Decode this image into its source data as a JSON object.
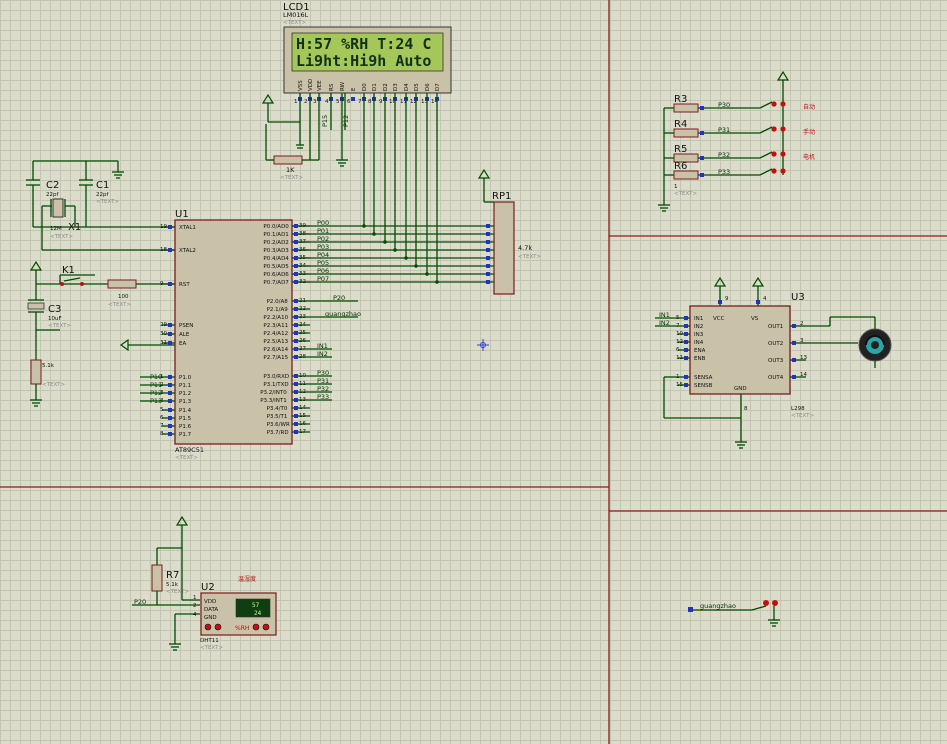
{
  "lcd": {
    "ref": "LCD1",
    "part": "LM016L",
    "text": "<TEXT>",
    "line1": "H:57 %RH T:24 C",
    "line2": "Li9ht:Hi9h  Auto",
    "pins": [
      "VSS",
      "VDD",
      "VEE",
      "RS",
      "RW",
      "E",
      "D0",
      "D1",
      "D2",
      "D3",
      "D4",
      "D5",
      "D6",
      "D7"
    ],
    "pin_nums": [
      "1",
      "2",
      "3",
      "4",
      "5",
      "6",
      "7",
      "8",
      "9",
      "10",
      "11",
      "12",
      "13",
      "14"
    ],
    "net_p15": "P15",
    "net_p12": "P12"
  },
  "mcu": {
    "ref": "U1",
    "part": "AT89C51",
    "text": "<TEXT>",
    "left_pins": [
      "XTAL1",
      "XTAL2",
      "RST",
      "PSEN",
      "ALE",
      "EA",
      "P1.0",
      "P1.1",
      "P1.2",
      "P1.3",
      "P1.4",
      "P1.5",
      "P1.6",
      "P1.7"
    ],
    "left_nums": [
      "19",
      "18",
      "9",
      "29",
      "30",
      "31",
      "1",
      "2",
      "3",
      "4",
      "5",
      "6",
      "7",
      "8"
    ],
    "right_pins": [
      "P0.0/AD0",
      "P0.1/AD1",
      "P0.2/AD2",
      "P0.3/AD3",
      "P0.4/AD4",
      "P0.5/AD5",
      "P0.6/AD6",
      "P0.7/AD7",
      "P2.0/A8",
      "P2.1/A9",
      "P2.2/A10",
      "P2.3/A11",
      "P2.4/A12",
      "P2.5/A13",
      "P2.6/A14",
      "P2.7/A15",
      "P3.0/RXD",
      "P3.1/TXD",
      "P3.2/INT0",
      "P3.3/INT1",
      "P3.4/T0",
      "P3.5/T1",
      "P3.6/WR",
      "P3.7/RD"
    ],
    "right_nums": [
      "39",
      "38",
      "37",
      "36",
      "35",
      "34",
      "33",
      "32",
      "21",
      "22",
      "23",
      "24",
      "25",
      "26",
      "27",
      "28",
      "10",
      "11",
      "12",
      "13",
      "14",
      "15",
      "16",
      "17"
    ],
    "p0_nets": [
      "P00",
      "P01",
      "P02",
      "P03",
      "P04",
      "P05",
      "P06",
      "P07"
    ],
    "p1_nets": [
      "P10",
      "P11",
      "P12",
      "P13"
    ],
    "net_p20": "P20",
    "net_guangzhao": "guangzhao",
    "net_in1": "IN1",
    "net_in2": "IN2",
    "p3_nets": [
      "P30",
      "P31",
      "P32",
      "P33"
    ]
  },
  "crystal": {
    "c2_ref": "C2",
    "c2_val": "22pf",
    "c1_ref": "C1",
    "c1_val": "22pf",
    "x1_ref": "X1",
    "x1_val": "12M",
    "text": "<TEXT>"
  },
  "reset": {
    "k1_ref": "K1",
    "r_val": "100",
    "c3_ref": "C3",
    "c3_val": "10uF",
    "r_pull_val": "5.1k",
    "text": "<TEXT>"
  },
  "lcd_pot": {
    "val": "1K",
    "text": "<TEXT>"
  },
  "rp1": {
    "ref": "RP1",
    "val": "4.7k",
    "text": "<TEXT>"
  },
  "buttons": {
    "refs": [
      "R3",
      "R4",
      "R5",
      "R6"
    ],
    "nets": [
      "P30",
      "P31",
      "P32",
      "P33"
    ],
    "labels": [
      "自动",
      "手动",
      "电机",
      ""
    ],
    "r_val": "1",
    "text": "<TEXT>"
  },
  "l298": {
    "ref": "U3",
    "part": "L298",
    "text": "<TEXT>",
    "left_pins": [
      "IN1",
      "IN2",
      "IN3",
      "IN4",
      "ENA",
      "ENB",
      "SENSA",
      "SENSB"
    ],
    "left_nums": [
      "5",
      "7",
      "10",
      "12",
      "6",
      "11",
      "1",
      "15"
    ],
    "right_pins": [
      "OUT1",
      "OUT2",
      "OUT3",
      "OUT4"
    ],
    "right_nums": [
      "2",
      "3",
      "13",
      "14"
    ],
    "top_pins": [
      "VCC",
      "VS"
    ],
    "top_nums": [
      "9",
      "4"
    ],
    "bottom_pin": "GND",
    "bottom_num": "8",
    "net_in1": "IN1",
    "net_in2": "IN2"
  },
  "dht": {
    "ref": "U2",
    "part": "DHT11",
    "text": "<TEXT>",
    "pins": [
      "VDD",
      "DATA",
      "GND"
    ],
    "pin_nums": [
      "1",
      "2",
      "4"
    ],
    "r7_ref": "R7",
    "r7_val": "5.1k",
    "net_p20": "P20",
    "label_cn": "温湿度",
    "hum": "57",
    "temp": "24",
    "unit": "%RH"
  },
  "ldr": {
    "net": "guangzhao"
  },
  "colors": {
    "wire": "#004b00",
    "border": "#8b1a1a",
    "component": "#c9c1a8",
    "lcd": "#a5c75a",
    "sheet": "#dcdccb"
  }
}
